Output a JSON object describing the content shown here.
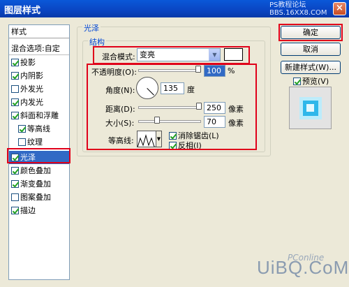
{
  "window": {
    "title": "图层样式",
    "watermark": "PS教程论坛",
    "watermark_url": "BBS.16XX8.COM",
    "close_glyph": "×"
  },
  "style_list": {
    "header": "样式",
    "blend_options": "混合选项:自定",
    "items": [
      {
        "label": "投影",
        "checked": true
      },
      {
        "label": "内阴影",
        "checked": true
      },
      {
        "label": "外发光",
        "checked": false
      },
      {
        "label": "内发光",
        "checked": true
      },
      {
        "label": "斜面和浮雕",
        "checked": true
      },
      {
        "label": "等高线",
        "checked": true
      },
      {
        "label": "纹理",
        "checked": false
      },
      {
        "label": "光泽",
        "checked": true
      },
      {
        "label": "颜色叠加",
        "checked": true
      },
      {
        "label": "渐变叠加",
        "checked": true
      },
      {
        "label": "图案叠加",
        "checked": false
      },
      {
        "label": "描边",
        "checked": true
      }
    ],
    "selected": "光泽"
  },
  "satin": {
    "group_title": "光泽",
    "structure_title": "结构",
    "blend_mode_label": "混合模式:",
    "blend_mode_value": "变亮",
    "opacity_label": "不透明度(O):",
    "opacity_value": "100",
    "opacity_unit": "%",
    "angle_label": "角度(N):",
    "angle_value": "135",
    "angle_unit": "度",
    "distance_label": "距离(D):",
    "distance_value": "250",
    "distance_unit": "像素",
    "size_label": "大小(S):",
    "size_value": "70",
    "size_unit": "像素",
    "contour_label": "等高线:",
    "antialias_label": "消除锯齿(L)",
    "antialias_checked": true,
    "invert_label": "反相(I)",
    "invert_checked": true
  },
  "buttons": {
    "ok": "确定",
    "cancel": "取消",
    "new_style": "新建样式(W)...",
    "preview_label": "预览(V)",
    "preview_checked": true
  },
  "branding": {
    "logo": "UiBQ.CoM",
    "sub": "PConline"
  }
}
